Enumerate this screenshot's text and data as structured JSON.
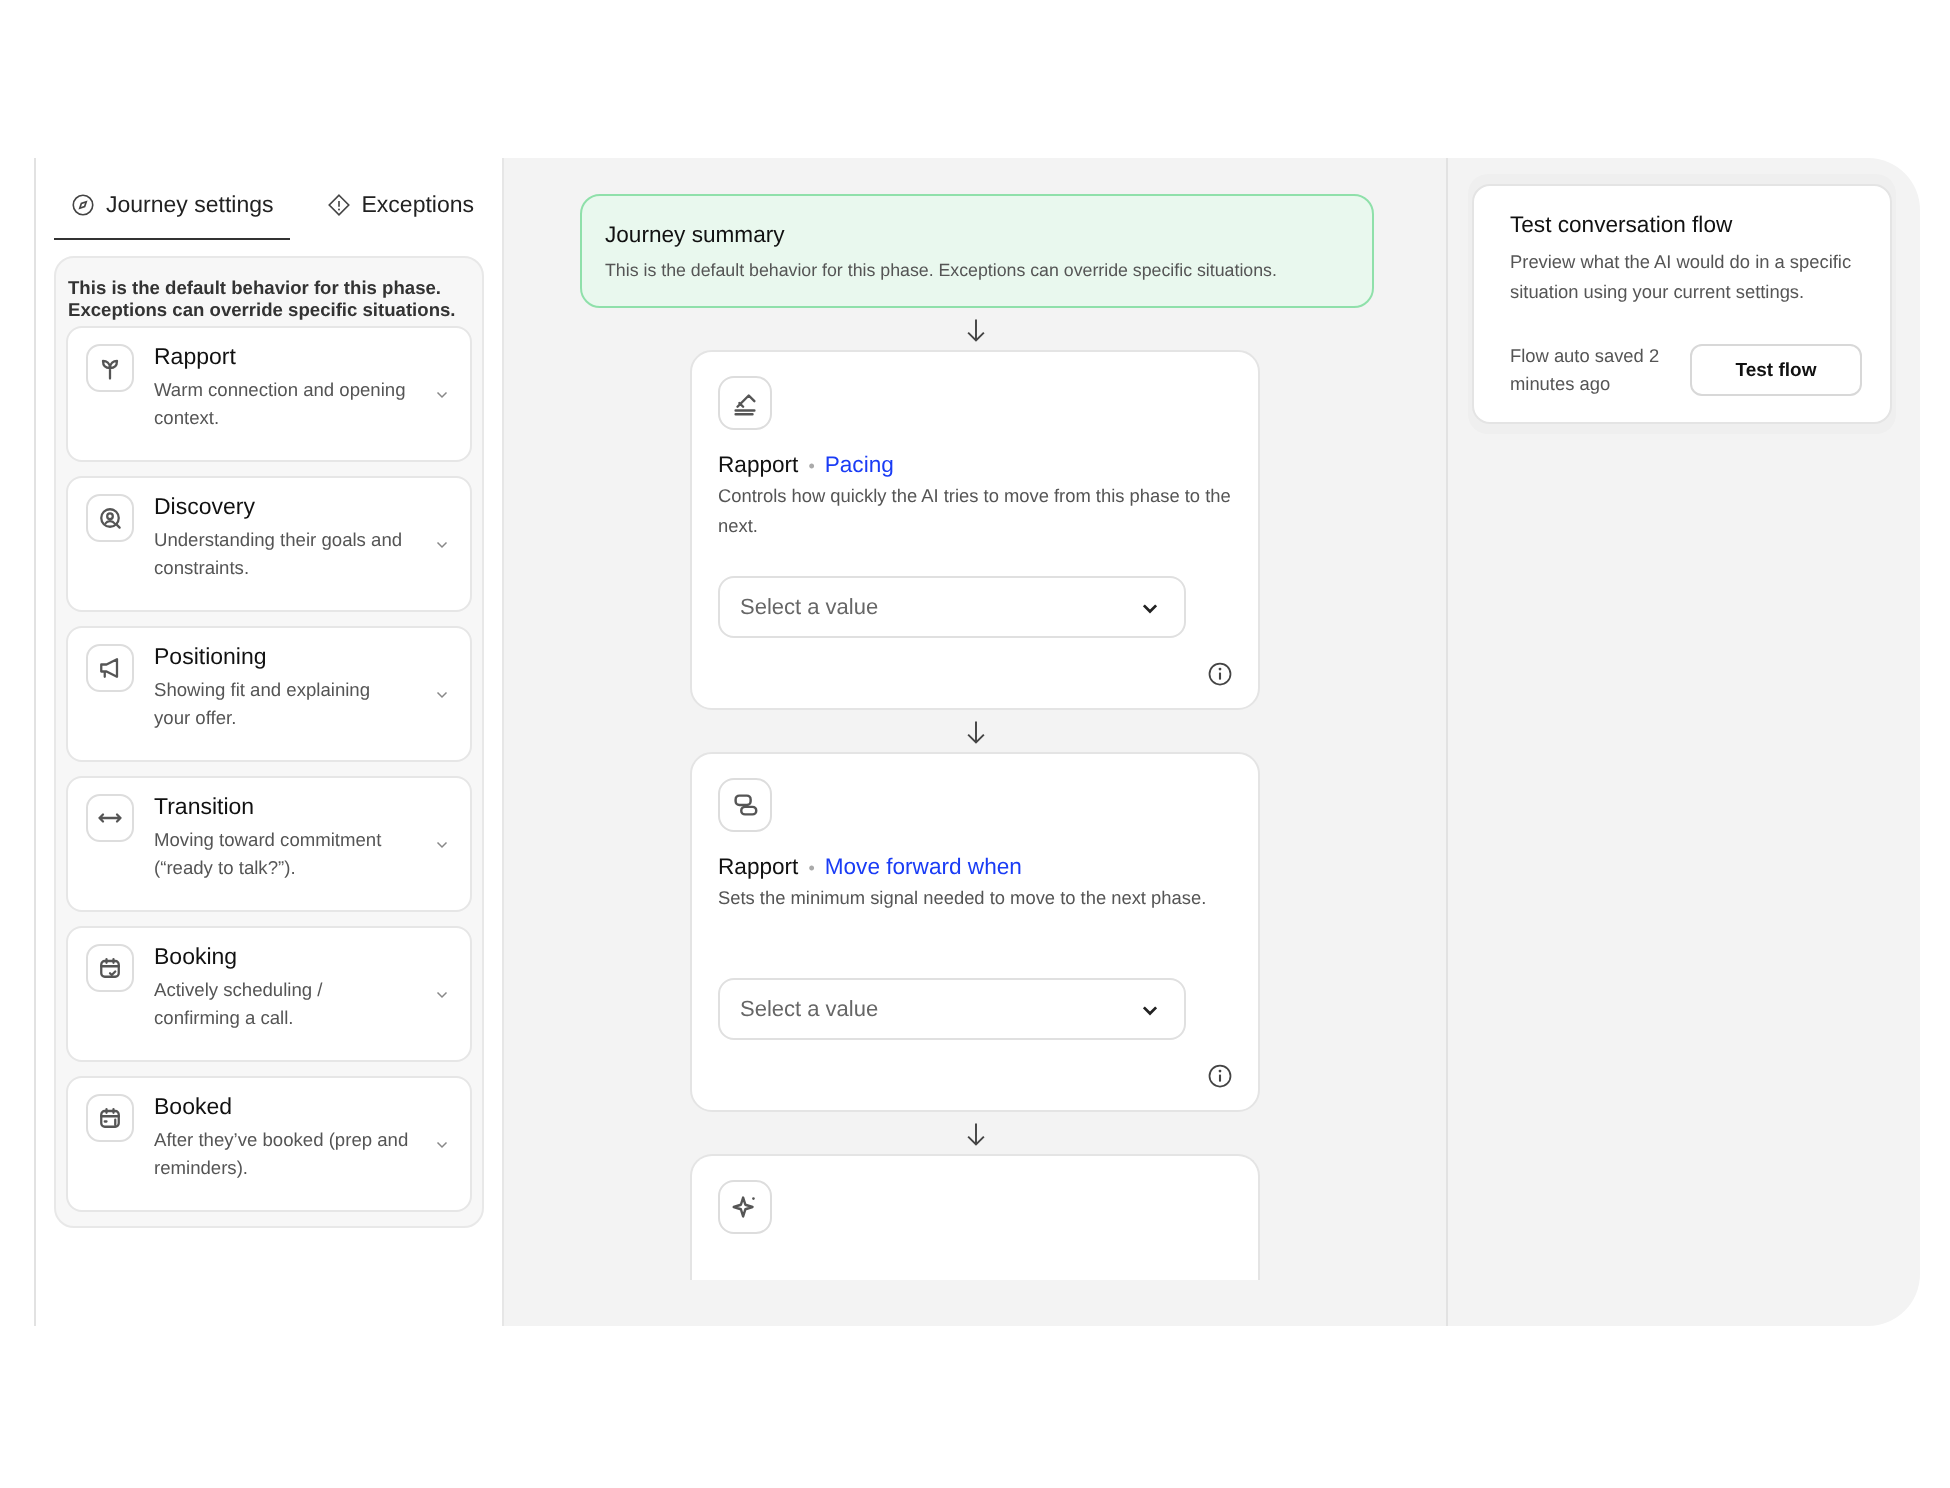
{
  "tabs": [
    {
      "label": "Journey settings",
      "selected": true
    },
    {
      "label": "Exceptions",
      "selected": false
    }
  ],
  "intro": "This is the default behavior for this phase. Exceptions can override specific situations.",
  "phases": [
    {
      "name": "Rapport",
      "description": "Warm connection and opening context.",
      "expanded": false
    },
    {
      "name": "Discovery",
      "description": "Understanding their goals and constraints.",
      "expanded": false
    },
    {
      "name": "Positioning",
      "description": "Showing fit and explaining your offer.",
      "expanded": false
    },
    {
      "name": "Transition",
      "description": "Moving toward commitment (“ready to talk?”).",
      "expanded": false
    },
    {
      "name": "Booking",
      "description": "Actively scheduling / confirming a call.",
      "expanded": false
    },
    {
      "name": "Booked",
      "description": "After they’ve booked (prep and reminders).",
      "expanded": false
    }
  ],
  "summary": {
    "title": "Journey summary",
    "text": "This is the default behavior for this phase. Exceptions can override specific situations."
  },
  "settings": [
    {
      "phase": "Rapport",
      "separator": "•",
      "name": "Pacing",
      "description": "Controls how quickly the AI tries to move from this phase to the next.",
      "placeholder": "Select a value"
    },
    {
      "phase": "Rapport",
      "separator": "•",
      "name": "Move forward when",
      "description": "Sets the minimum signal needed to move to the next phase.",
      "placeholder": "Select a value"
    },
    {
      "kind": "partial"
    }
  ],
  "test_panel": {
    "title": "Test conversation flow",
    "text": "Preview what the AI would do in a specific situation using your current settings.",
    "status": "Flow auto saved 2 minutes ago",
    "button": "Test flow"
  }
}
